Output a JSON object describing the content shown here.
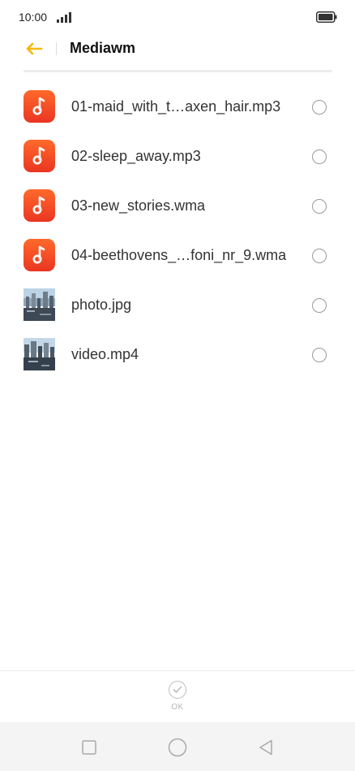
{
  "status_bar": {
    "time": "10:00"
  },
  "header": {
    "title": "Mediawm"
  },
  "files": [
    {
      "name": "01-maid_with_t…axen_hair.mp3",
      "kind": "music-icon"
    },
    {
      "name": "02-sleep_away.mp3",
      "kind": "music-icon"
    },
    {
      "name": "03-new_stories.wma",
      "kind": "music-icon"
    },
    {
      "name": "04-beethovens_…foni_nr_9.wma",
      "kind": "music-icon"
    },
    {
      "name": "photo.jpg",
      "kind": "photo-thumbnail"
    },
    {
      "name": "video.mp4",
      "kind": "video-thumbnail"
    }
  ],
  "footer": {
    "ok_label": "OK"
  },
  "colors": {
    "accent_back_arrow": "#f5b800",
    "music_icon_top": "#ff6a2b",
    "music_icon_bottom": "#ea3522"
  }
}
